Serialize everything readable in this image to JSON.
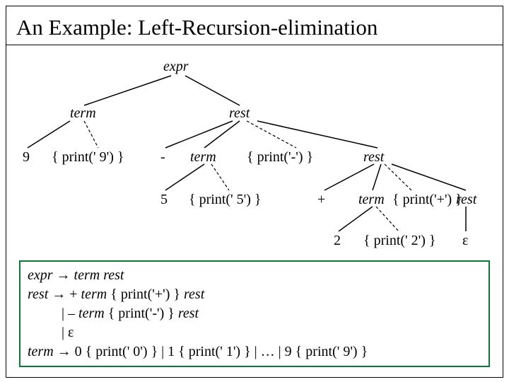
{
  "title": "An Example: Left-Recursion-elimination",
  "tree": {
    "expr": "expr",
    "term1": "term",
    "rest1": "rest",
    "l9": "9",
    "p9": "{ print(' 9') }",
    "minus": "-",
    "term2": "term",
    "pminus": "{ print('-') }",
    "rest2": "rest",
    "l5": "5",
    "p5": "{ print(' 5') }",
    "plus": "+",
    "term3": "term",
    "pplus": "{ print('+') }",
    "rest3": "rest",
    "l2": "2",
    "p2": "{ print(' 2') }",
    "eps": "ε"
  },
  "grammar": {
    "l1a": "expr",
    "l1b": " → ",
    "l1c": "term rest",
    "l2a": "rest",
    "l2b": " → + ",
    "l2c": "term",
    "l2d": "  { print('+') } ",
    "l2e": "rest",
    "l3a": "|   – ",
    "l3b": "term",
    "l3c": "  { print('-') } ",
    "l3d": "rest",
    "l4a": "|   ε",
    "l5a": "term",
    "l5b": " → 0 { print(' 0') }  |   1  { print(' 1') }  |  … | 9  { print(' 9') }"
  }
}
